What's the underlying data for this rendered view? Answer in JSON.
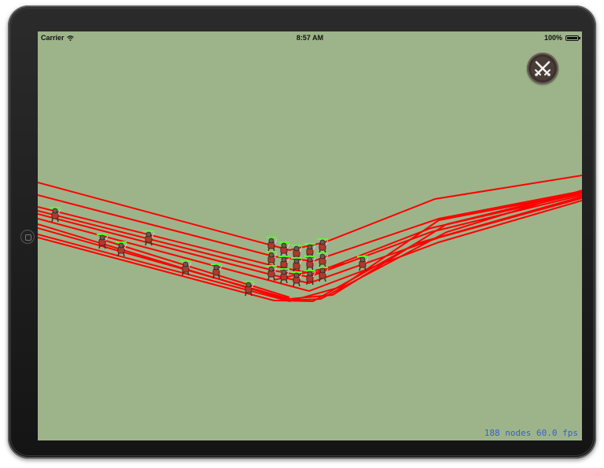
{
  "status_bar": {
    "carrier": "Carrier",
    "time": "8:57 AM",
    "battery_text": "100%",
    "battery_level": 1.0
  },
  "battle_button": {
    "icon": "crossed-swords-icon"
  },
  "stats": {
    "text": "188 nodes 60.0 fps"
  },
  "colors": {
    "field": "#9db48a",
    "path": "#ff0000",
    "unit_armor": "#b5382c",
    "health_bar": "#5cff2a",
    "stats_text": "#3a5fc9"
  }
}
